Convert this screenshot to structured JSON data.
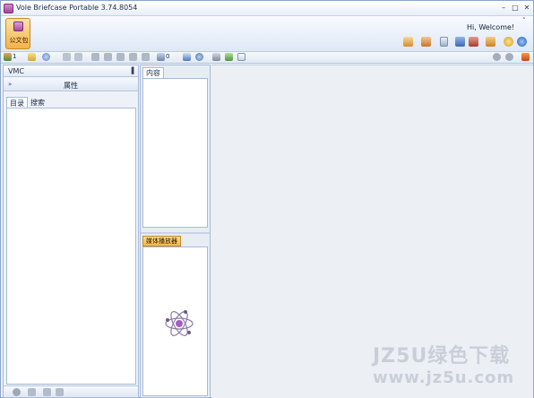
{
  "window": {
    "title": "Vole Briefcase Portable  3.74.8054",
    "minimize": "–",
    "maximize": "□",
    "close": "✕"
  },
  "ribbon": {
    "briefcase_label": "公文包",
    "welcome": "Hi, Welcome!",
    "collapse": "˄",
    "right_icons": [
      "paint-icon",
      "tools-icon",
      "book-icon",
      "shield-icon",
      "web-icon",
      "ruler-icon",
      "medal-icon",
      "info-icon"
    ]
  },
  "toolbar": {
    "count_1": "1",
    "count_2": "0",
    "items": [
      "chart-icon",
      "folder-icon",
      "disk-icon",
      "back-icon",
      "forward-icon",
      "doc1-icon",
      "doc2-icon",
      "doc3-icon",
      "doc4-icon",
      "doc5-icon",
      "calc-icon",
      "abc-icon",
      "sync-icon",
      "clock-icon",
      "edit-icon",
      "layout-icon",
      "nav-back-icon",
      "nav-forward-icon",
      "office-icon"
    ]
  },
  "left_pane": {
    "vmc_label": "VMC",
    "pin": "▐",
    "props_chevron": "»",
    "props_label": "属性",
    "tab_toc": "目录",
    "tab_search": "搜索"
  },
  "middle_pane": {
    "content_tab": "内容",
    "media_tab": "媒体播放器"
  },
  "main_area": {
    "watermark_1": "JZ5U绿色下载",
    "watermark_2": "www.jz5u.com"
  },
  "colors": {
    "accent_orange": "#f3b348",
    "frame_blue": "#a6bbd8",
    "briefcase_purple": "#a34d9b"
  }
}
